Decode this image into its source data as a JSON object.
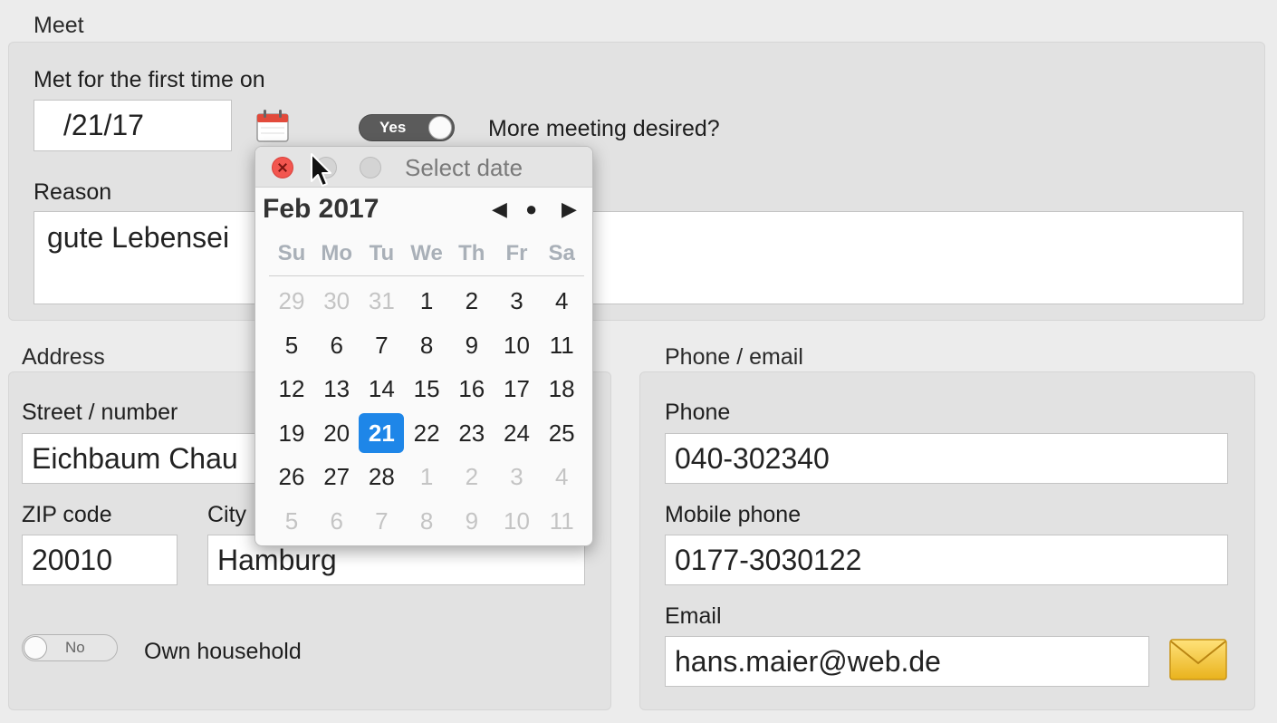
{
  "meet": {
    "section_label": "Meet",
    "first_met_label": "Met for the first time on",
    "date_value": "/21/17",
    "more_meeting_toggle": "Yes",
    "more_meeting_label": "More meeting desired?",
    "reason_label": "Reason",
    "reason_value": "gute Lebensei"
  },
  "address": {
    "section_label": "Address",
    "street_label": "Street / number",
    "street_value": "Eichbaum Chau",
    "zip_label": "ZIP code",
    "zip_value": "20010",
    "city_label": "City",
    "city_value": "Hamburg",
    "household_toggle": "No",
    "household_label": "Own household"
  },
  "contact": {
    "section_label": "Phone / email",
    "phone_label": "Phone",
    "phone_value": "040-302340",
    "mobile_label": "Mobile phone",
    "mobile_value": "0177-3030122",
    "email_label": "Email",
    "email_value": "hans.maier@web.de"
  },
  "datepicker": {
    "title": "Select date",
    "month_year": "Feb 2017",
    "nav_prev": "◀",
    "nav_today": "●",
    "nav_next": "▶",
    "weekdays": [
      "Su",
      "Mo",
      "Tu",
      "We",
      "Th",
      "Fr",
      "Sa"
    ],
    "weeks": [
      [
        {
          "d": "29",
          "m": true
        },
        {
          "d": "30",
          "m": true
        },
        {
          "d": "31",
          "m": true
        },
        {
          "d": "1"
        },
        {
          "d": "2"
        },
        {
          "d": "3"
        },
        {
          "d": "4"
        }
      ],
      [
        {
          "d": "5"
        },
        {
          "d": "6"
        },
        {
          "d": "7"
        },
        {
          "d": "8"
        },
        {
          "d": "9"
        },
        {
          "d": "10"
        },
        {
          "d": "11"
        }
      ],
      [
        {
          "d": "12"
        },
        {
          "d": "13"
        },
        {
          "d": "14"
        },
        {
          "d": "15"
        },
        {
          "d": "16"
        },
        {
          "d": "17"
        },
        {
          "d": "18"
        }
      ],
      [
        {
          "d": "19"
        },
        {
          "d": "20"
        },
        {
          "d": "21",
          "sel": true
        },
        {
          "d": "22"
        },
        {
          "d": "23"
        },
        {
          "d": "24"
        },
        {
          "d": "25"
        }
      ],
      [
        {
          "d": "26"
        },
        {
          "d": "27"
        },
        {
          "d": "28"
        },
        {
          "d": "1",
          "m": true
        },
        {
          "d": "2",
          "m": true
        },
        {
          "d": "3",
          "m": true
        },
        {
          "d": "4",
          "m": true
        }
      ],
      [
        {
          "d": "5",
          "m": true
        },
        {
          "d": "6",
          "m": true
        },
        {
          "d": "7",
          "m": true
        },
        {
          "d": "8",
          "m": true
        },
        {
          "d": "9",
          "m": true
        },
        {
          "d": "10",
          "m": true
        },
        {
          "d": "11",
          "m": true
        }
      ]
    ],
    "selected_color": "#1e86e8"
  },
  "icons": {
    "calendar": "calendar-icon",
    "mail": "envelope-icon",
    "cursor": "mouse-pointer-icon"
  }
}
